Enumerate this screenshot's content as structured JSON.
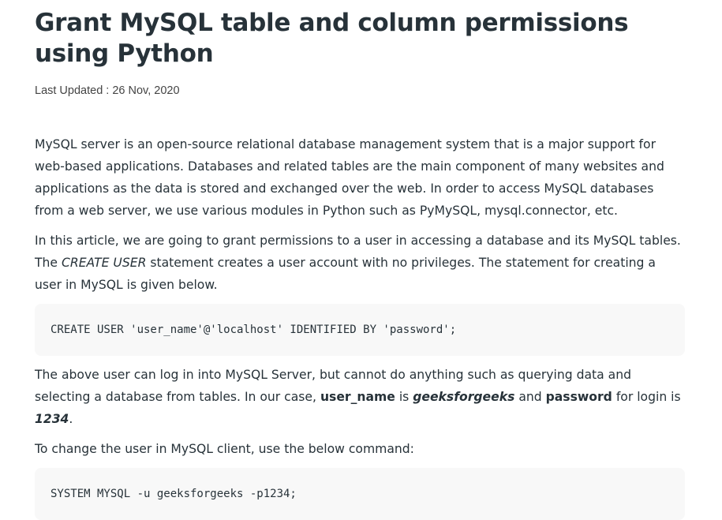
{
  "article": {
    "title": "Grant MySQL table and column permissions using Python",
    "last_updated": "Last Updated : 26 Nov, 2020",
    "p1": "MySQL server is an open-source relational database management system that is a major support for web-based applications. Databases and related tables are the main component of many websites and applications as the data is stored and exchanged over the web. In order to access MySQL databases from a web server, we use various modules in Python such as PyMySQL, mysql.connector, etc.",
    "p2": {
      "before": "In this article, we are going to grant permissions to a user in accessing a database and its MySQL tables. The ",
      "em": "CREATE USER",
      "after": " statement creates a user account with no privileges. The statement for creating a user in MySQL is given below."
    },
    "code1": "CREATE USER 'user_name'@'localhost' IDENTIFIED BY 'password';",
    "p3": {
      "before": "The above user can log in into MySQL Server, but cannot do anything such as querying data and selecting a database from tables. In our case,  ",
      "user_name_label": "user_name",
      "is1": " is ",
      "user_name_value": "geeksforgeeks",
      "and": " and ",
      "password_label": "password",
      "for_login": " for login is ",
      "password_value": "1234",
      "end": "."
    },
    "p4": "To change the user in MySQL client, use the below command:",
    "code2": "SYSTEM MYSQL -u geeksforgeeks -p1234;"
  }
}
